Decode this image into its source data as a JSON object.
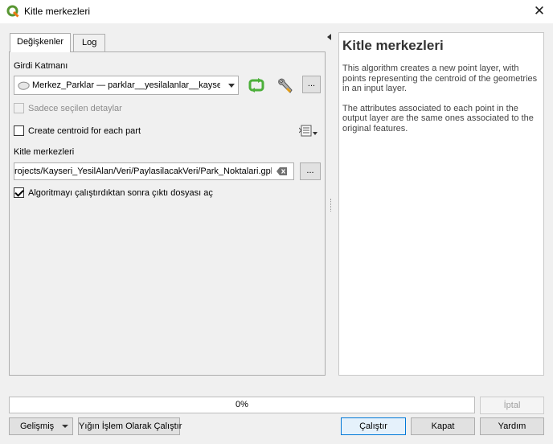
{
  "window": {
    "title": "Kitle merkezleri",
    "close_label": "✕"
  },
  "tabs": [
    {
      "label": "Değişkenler",
      "active": true
    },
    {
      "label": "Log",
      "active": false
    }
  ],
  "params": {
    "input_layer_label": "Girdi Katmanı",
    "input_layer_value": "Merkez_Parklar — parklar__yesilalanlar__kayseri",
    "selected_only_label": "Sadece seçilen detaylar",
    "selected_only_checked": false,
    "selected_only_enabled": false,
    "centroid_each_part_label": "Create centroid for each part",
    "centroid_each_part_checked": false,
    "output_label": "Kitle merkezleri",
    "output_value": "rojects/Kayseri_YesilAlan/Veri/PaylasilacakVeri/Park_Noktalari.gpkg",
    "open_output_label": "Algoritmayı çalıştırdıktan sonra çıktı dosyası aç",
    "open_output_checked": true,
    "ellipsis_label": "..."
  },
  "help": {
    "title": "Kitle merkezleri",
    "paragraphs": [
      "This algorithm creates a new point layer, with points representing the centroid of the geometries in an input layer.",
      "The attributes associated to each point in the output layer are the same ones associated to the original features."
    ]
  },
  "progress": {
    "value": 0,
    "text": "0%"
  },
  "buttons": {
    "cancel": "İptal",
    "advanced": "Gelişmiş",
    "batch": "Yığın İşlem Olarak Çalıştır",
    "run": "Çalıştır",
    "close": "Kapat",
    "help": "Yardım"
  },
  "colors": {
    "qgis_green": "#589632",
    "qgis_yellow": "#ee7913",
    "accent_blue": "#0078d7"
  }
}
